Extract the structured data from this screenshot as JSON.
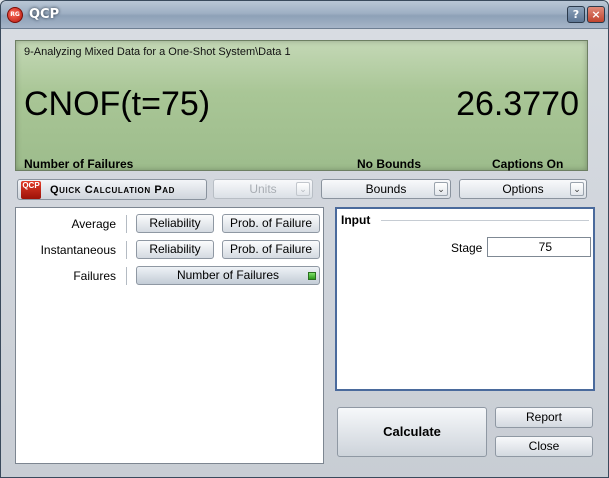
{
  "window": {
    "title": "QCP",
    "app_icon_text": "RG",
    "help_label": "?",
    "close_label": "×"
  },
  "display": {
    "path": "9-Analyzing Mixed Data for a One-Shot System\\Data 1",
    "function": "CNOF(t=75)",
    "value": "26.3770",
    "status_left": "Number of Failures",
    "status_mid": "No Bounds",
    "status_right": "Captions On"
  },
  "toolbar": {
    "logo_text": "QCP",
    "pad_label": "Quick Calculation Pad",
    "units_label": "Units",
    "bounds_label": "Bounds",
    "options_label": "Options",
    "dropdown_arrow": "⌄"
  },
  "functions": {
    "rows": [
      {
        "label": "Average",
        "buttons": [
          "Reliability",
          "Prob. of Failure"
        ]
      },
      {
        "label": "Instantaneous",
        "buttons": [
          "Reliability",
          "Prob. of Failure"
        ]
      },
      {
        "label": "Failures",
        "buttons": [
          "Number of Failures"
        ]
      }
    ]
  },
  "input": {
    "group_title": "Input",
    "stage_label": "Stage",
    "stage_value": "75"
  },
  "actions": {
    "calculate": "Calculate",
    "report": "Report",
    "close": "Close"
  }
}
